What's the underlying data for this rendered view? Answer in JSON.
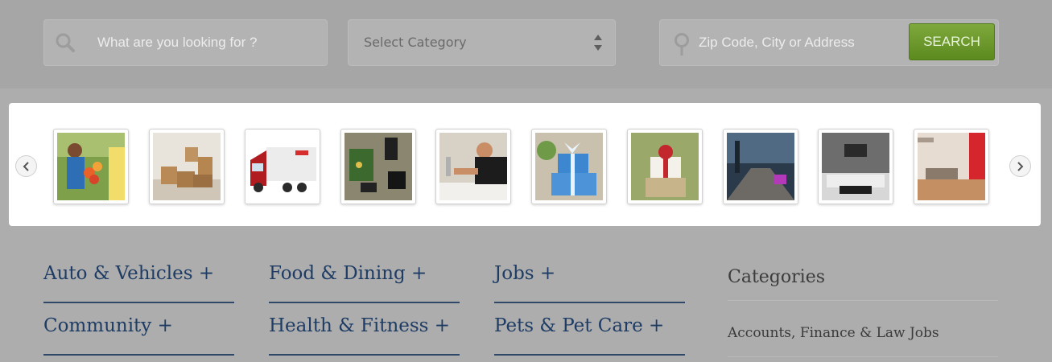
{
  "search": {
    "keyword_placeholder": "What are you looking for ?",
    "keyword_value": "",
    "category_selected": "Select Category",
    "location_placeholder": "Zip Code, City or Address",
    "location_value": "",
    "button_label": "SEARCH"
  },
  "carousel": {
    "items": [
      {
        "icon": "florist-delivery-image"
      },
      {
        "icon": "moving-boxes-image"
      },
      {
        "icon": "cargo-truck-image"
      },
      {
        "icon": "electronics-repair-image"
      },
      {
        "icon": "plumber-image"
      },
      {
        "icon": "gift-boxes-image"
      },
      {
        "icon": "gift-box-image"
      },
      {
        "icon": "lobby-interior-image"
      },
      {
        "icon": "living-room-interior-image"
      },
      {
        "icon": "modern-interior-image"
      }
    ]
  },
  "categories": {
    "col1": [
      "Auto & Vehicles +",
      "Community +"
    ],
    "col2": [
      "Food & Dining +",
      "Health & Fitness +"
    ],
    "col3": [
      "Jobs +",
      "Pets & Pet Care +"
    ]
  },
  "sidebar": {
    "heading": "Categories",
    "items": [
      "Accounts, Finance & Law Jobs"
    ]
  },
  "colors": {
    "accent_green": "#6b9a2c",
    "link_blue": "#1e3c64"
  }
}
